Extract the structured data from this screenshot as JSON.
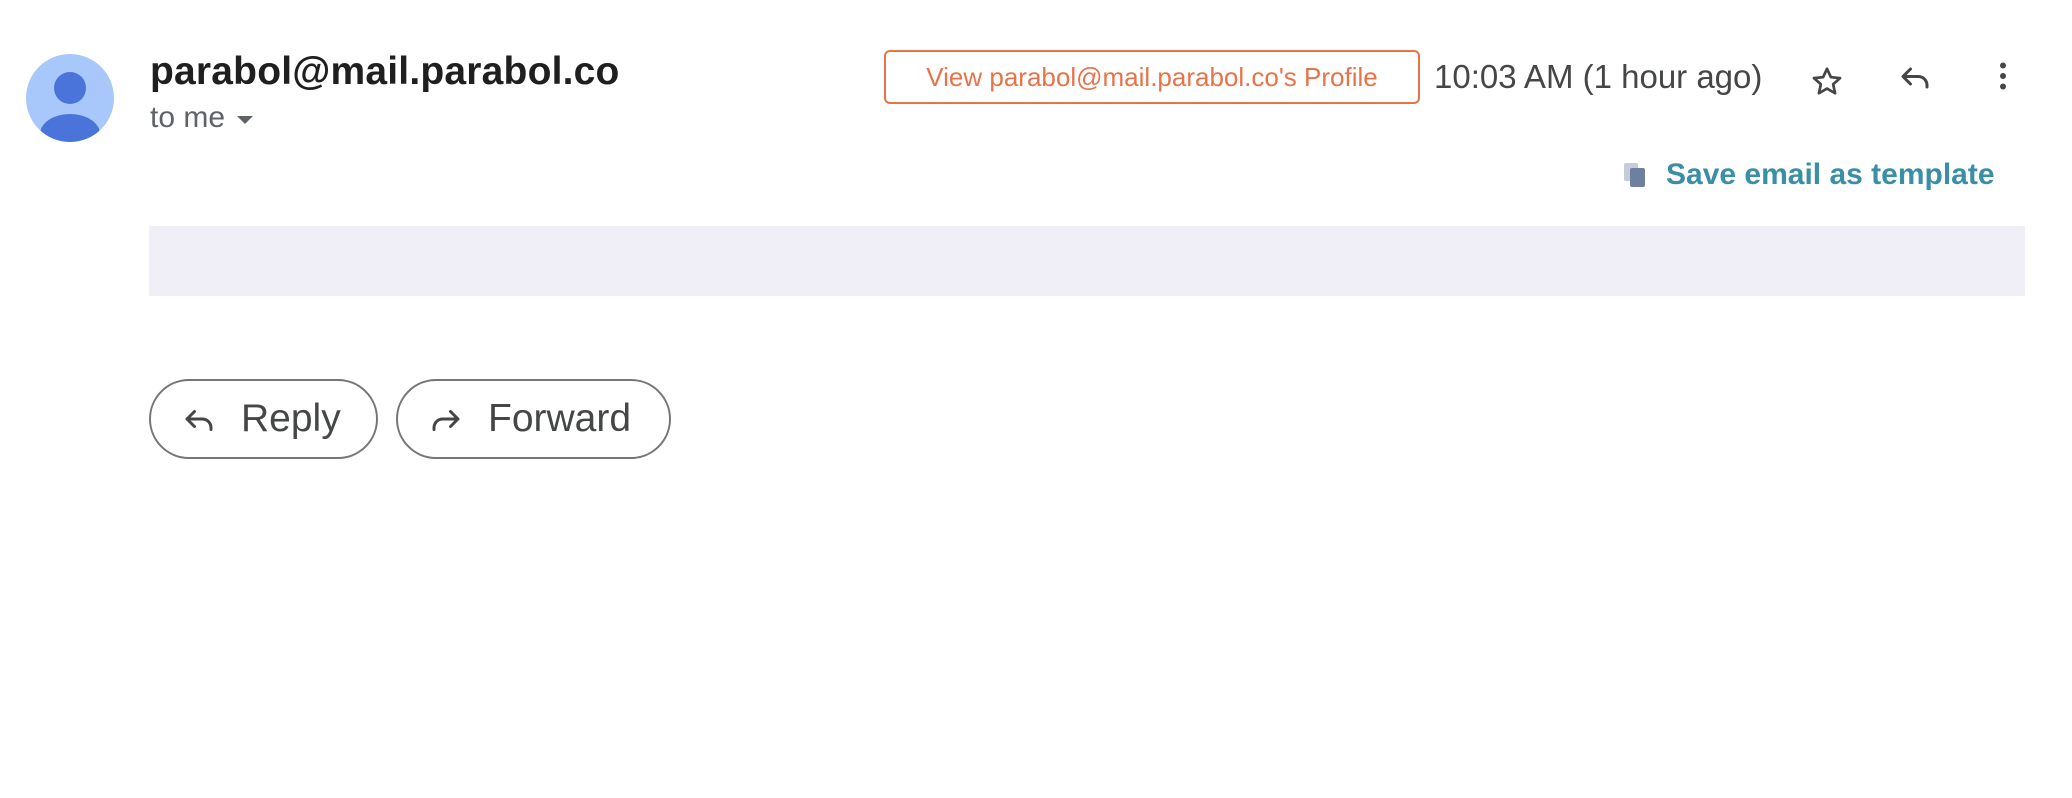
{
  "header": {
    "sender": "parabol@mail.parabol.co",
    "recipient_label": "to me",
    "profile_button_label": "View parabol@mail.parabol.co's Profile",
    "timestamp": "10:03 AM (1 hour ago)"
  },
  "actions": {
    "save_template_label": "Save email as template",
    "reply_label": "Reply",
    "forward_label": "Forward"
  },
  "icons": {
    "avatar": "person-avatar-icon",
    "recipient_details": "chevron-down-icon",
    "star": "star-icon",
    "reply": "reply-icon",
    "more": "more-vertical-icon",
    "template": "copy-icon",
    "forward": "forward-icon"
  },
  "colors": {
    "profile_accent": "#e8734a",
    "template_link": "#3a8ea6",
    "avatar_bg": "#a8c7fa",
    "avatar_fg": "#4a74d9",
    "body_bar": "#f0eff8"
  }
}
